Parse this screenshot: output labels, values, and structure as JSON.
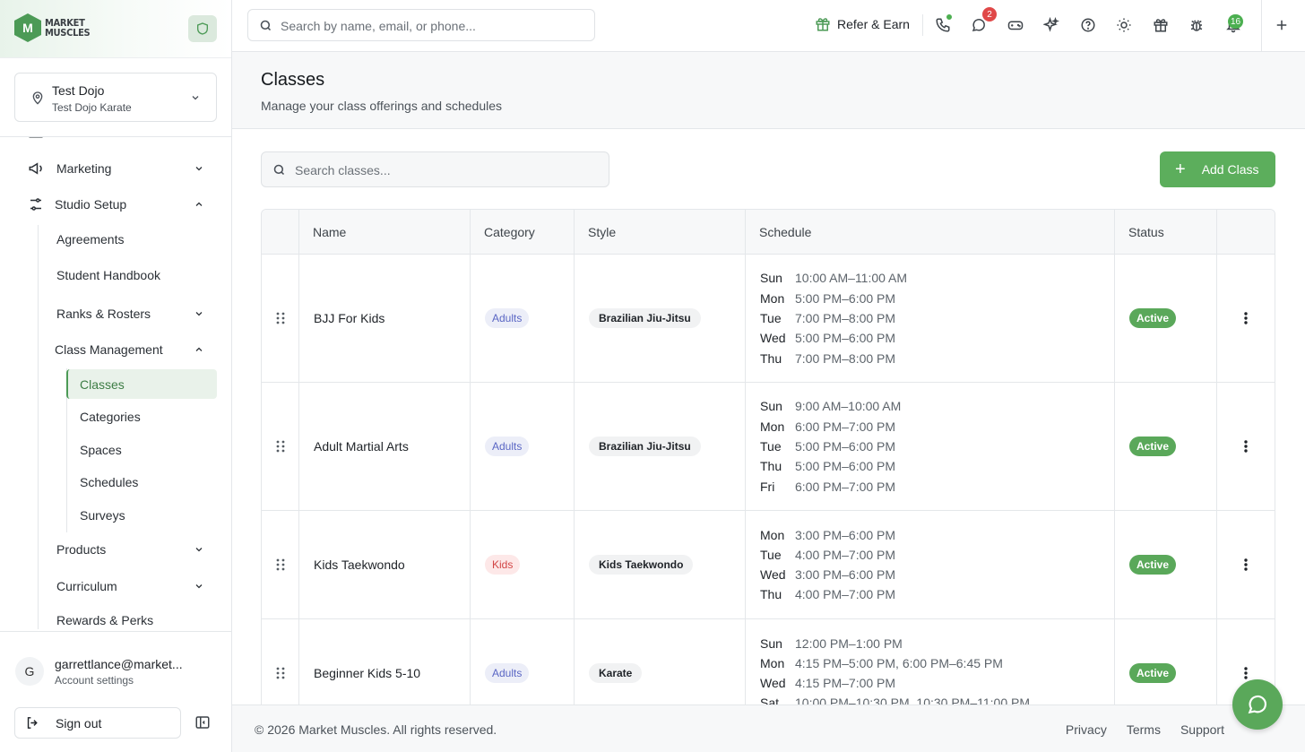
{
  "brand": {
    "logo_line1": "MARKET",
    "logo_line2": "MUSCLES"
  },
  "location": {
    "name": "Test Dojo",
    "sub": "Test Dojo Karate"
  },
  "nav": {
    "marketing": "Marketing",
    "studio_setup": "Studio Setup",
    "agreements": "Agreements",
    "student_handbook": "Student Handbook",
    "ranks_rosters": "Ranks & Rosters",
    "class_management": "Class Management",
    "classes": "Classes",
    "categories": "Categories",
    "spaces": "Spaces",
    "schedules": "Schedules",
    "surveys": "Surveys",
    "products": "Products",
    "curriculum": "Curriculum",
    "rewards": "Rewards & Perks"
  },
  "user": {
    "initial": "G",
    "email": "garrettlance@market...",
    "account": "Account settings",
    "sign_out": "Sign out"
  },
  "topbar": {
    "search_placeholder": "Search by name, email, or phone...",
    "refer": "Refer & Earn",
    "messages_badge": "2",
    "notifications_badge": "16"
  },
  "header": {
    "title": "Classes",
    "subtitle": "Manage your class offerings and schedules"
  },
  "toolbar": {
    "search_placeholder": "Search classes...",
    "add_label": "Add Class"
  },
  "table": {
    "headers": {
      "name": "Name",
      "category": "Category",
      "style": "Style",
      "schedule": "Schedule",
      "status": "Status"
    },
    "rows": [
      {
        "name": "BJJ For Kids",
        "category": "Adults",
        "style": "Brazilian Jiu-Jitsu",
        "status": "Active",
        "schedule": [
          {
            "day": "Sun",
            "time": "10:00 AM–11:00 AM"
          },
          {
            "day": "Mon",
            "time": "5:00 PM–6:00 PM"
          },
          {
            "day": "Tue",
            "time": "7:00 PM–8:00 PM"
          },
          {
            "day": "Wed",
            "time": "5:00 PM–6:00 PM"
          },
          {
            "day": "Thu",
            "time": "7:00 PM–8:00 PM"
          }
        ]
      },
      {
        "name": "Adult Martial Arts",
        "category": "Adults",
        "style": "Brazilian Jiu-Jitsu",
        "status": "Active",
        "schedule": [
          {
            "day": "Sun",
            "time": "9:00 AM–10:00 AM"
          },
          {
            "day": "Mon",
            "time": "6:00 PM–7:00 PM"
          },
          {
            "day": "Tue",
            "time": "5:00 PM–6:00 PM"
          },
          {
            "day": "Thu",
            "time": "5:00 PM–6:00 PM"
          },
          {
            "day": "Fri",
            "time": "6:00 PM–7:00 PM"
          }
        ]
      },
      {
        "name": "Kids Taekwondo",
        "category": "Kids",
        "style": "Kids Taekwondo",
        "status": "Active",
        "schedule": [
          {
            "day": "Mon",
            "time": "3:00 PM–6:00 PM"
          },
          {
            "day": "Tue",
            "time": "4:00 PM–7:00 PM"
          },
          {
            "day": "Wed",
            "time": "3:00 PM–6:00 PM"
          },
          {
            "day": "Thu",
            "time": "4:00 PM–7:00 PM"
          }
        ]
      },
      {
        "name": "Beginner Kids 5-10",
        "category": "Adults",
        "style": "Karate",
        "status": "Active",
        "schedule": [
          {
            "day": "Sun",
            "time": "12:00 PM–1:00 PM"
          },
          {
            "day": "Mon",
            "time": "4:15 PM–5:00 PM, 6:00 PM–6:45 PM"
          },
          {
            "day": "Wed",
            "time": "4:15 PM–7:00 PM"
          },
          {
            "day": "Sat",
            "time": "10:00 PM–10:30 PM, 10:30 PM–11:00 PM"
          }
        ]
      }
    ]
  },
  "footer": {
    "copyright": "© 2026 Market Muscles. All rights reserved.",
    "privacy": "Privacy",
    "terms": "Terms",
    "support": "Support"
  },
  "colors": {
    "accent": "#5aa85a",
    "badge_red": "#e04848",
    "badge_green": "#4caf50"
  }
}
